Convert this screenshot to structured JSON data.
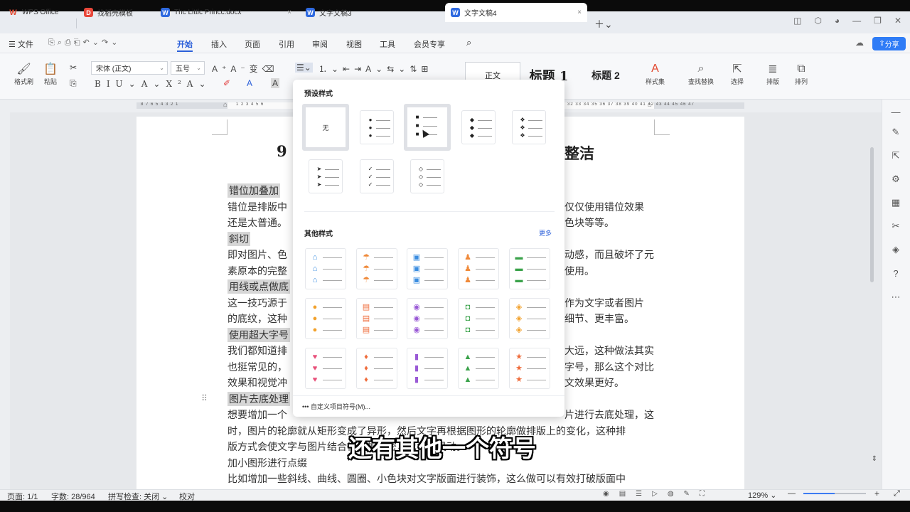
{
  "tabs": [
    {
      "label": "WPS Office",
      "icon": "wps-logo-icon"
    },
    {
      "label": "找稻壳模板",
      "icon": "docer-icon"
    },
    {
      "label": "Thc Littlc Princc.docx",
      "icon": "word-doc-icon"
    },
    {
      "label": "文字文稿3",
      "icon": "word-doc-icon"
    },
    {
      "label": "文字文稿4",
      "icon": "word-doc-icon"
    }
  ],
  "menu": {
    "file": "文件",
    "items": [
      "开始",
      "插入",
      "页面",
      "引用",
      "审阅",
      "视图",
      "工具",
      "会员专享"
    ],
    "active": "开始",
    "share": "分享"
  },
  "ribbon": {
    "format_painter": "格式刷",
    "paste": "粘贴",
    "font_name": "宋体 (正文)",
    "font_size": "五号",
    "styles": {
      "normal": "正文",
      "h1": "标题 1",
      "h2": "标题 2"
    },
    "style_set": "样式集",
    "find_replace": "查找替换",
    "select": "选择",
    "layout": "排版",
    "arrange": "排列"
  },
  "ruler": {
    "left_ticks": "8 7 6 5 4 3 2 1",
    "mid_ticks": "1 2 3 4 5 6",
    "right_ticks": "32 33 34 35 36 37 38 39 40 41 42 43 44 45 46 47"
  },
  "document": {
    "title_left": "9",
    "title_right": "整洁",
    "lines": [
      {
        "left": "错位加叠加",
        "right": "",
        "highlight": true
      },
      {
        "left": "错位是排版中",
        "right": "仅仅使用错位效果"
      },
      {
        "left": "还是太普通。",
        "right": "色块等等。"
      },
      {
        "left": "斜切",
        "right": "",
        "highlight": true
      },
      {
        "left": "即对图片、色",
        "right": "动感，而且破坏了元"
      },
      {
        "left": "素原本的完整",
        "right": "使用。"
      },
      {
        "left": "用线或点做底",
        "right": "",
        "highlight": true
      },
      {
        "left": "这一技巧源于",
        "right": "作为文字或者图片"
      },
      {
        "left": "的底纹，这种",
        "right": "细节、更丰富。"
      },
      {
        "left": "使用超大字号",
        "right": "",
        "highlight": true
      },
      {
        "left": "我们都知道排",
        "right": "大远，这种做法其实"
      },
      {
        "left": "也挺常见的，",
        "right": "字号，那么这个对比"
      },
      {
        "left": "效果和视觉冲",
        "right": "文效果更好。"
      },
      {
        "left": "图片去底处理",
        "right": "",
        "highlight": true
      },
      {
        "left": "想要增加一个",
        "right": "片进行去底处理，这"
      },
      {
        "left": "时，图片的轮廓就从矩形变成了异形，然后文字再根据图形的轮廓做排版上的变化，这种排",
        "right": ""
      },
      {
        "left": "版方式会使文字与图片结合得更加紧密，也更显灵动。",
        "right": ""
      },
      {
        "left": "加小图形进行点缀",
        "right": ""
      },
      {
        "left": "比如增加一些斜线、曲线、圆圈、小色块对文字版面进行装饰，这么做可以有效打破版面中",
        "right": ""
      }
    ]
  },
  "dropdown": {
    "preset_title": "预设样式",
    "none_label": "无",
    "other_title": "其他样式",
    "more": "更多",
    "custom": "自定义项目符号(M)...",
    "preset_glyphs": [
      "●",
      "■",
      "◆",
      "❖",
      "➤",
      "✓",
      "◇"
    ],
    "other_rows": [
      [
        {
          "g": "⌂",
          "c": "#3b8de0"
        },
        {
          "g": "☂",
          "c": "#f08a3a"
        },
        {
          "g": "▣",
          "c": "#3b8de0"
        },
        {
          "g": "♟",
          "c": "#f08a3a"
        },
        {
          "g": "▬",
          "c": "#3aa24a"
        }
      ],
      [
        {
          "g": "●",
          "c": "#f2a12b"
        },
        {
          "g": "▤",
          "c": "#ef6b3a"
        },
        {
          "g": "◉",
          "c": "#9a5ad6"
        },
        {
          "g": "◘",
          "c": "#3aa24a"
        },
        {
          "g": "◈",
          "c": "#f2a12b"
        }
      ],
      [
        {
          "g": "♥",
          "c": "#e8507a"
        },
        {
          "g": "♦",
          "c": "#ef6b3a"
        },
        {
          "g": "▮",
          "c": "#9a5ad6"
        },
        {
          "g": "▲",
          "c": "#3aa24a"
        },
        {
          "g": "★",
          "c": "#ef6b3a"
        }
      ]
    ]
  },
  "status": {
    "page": "页面: 1/1",
    "words": "字数: 28/964",
    "spell": "拼写检查: 关闭",
    "proof": "校对",
    "zoom": "129%",
    "zoom_fraction": 0.5
  },
  "subtitle": "还有其他一个符号"
}
